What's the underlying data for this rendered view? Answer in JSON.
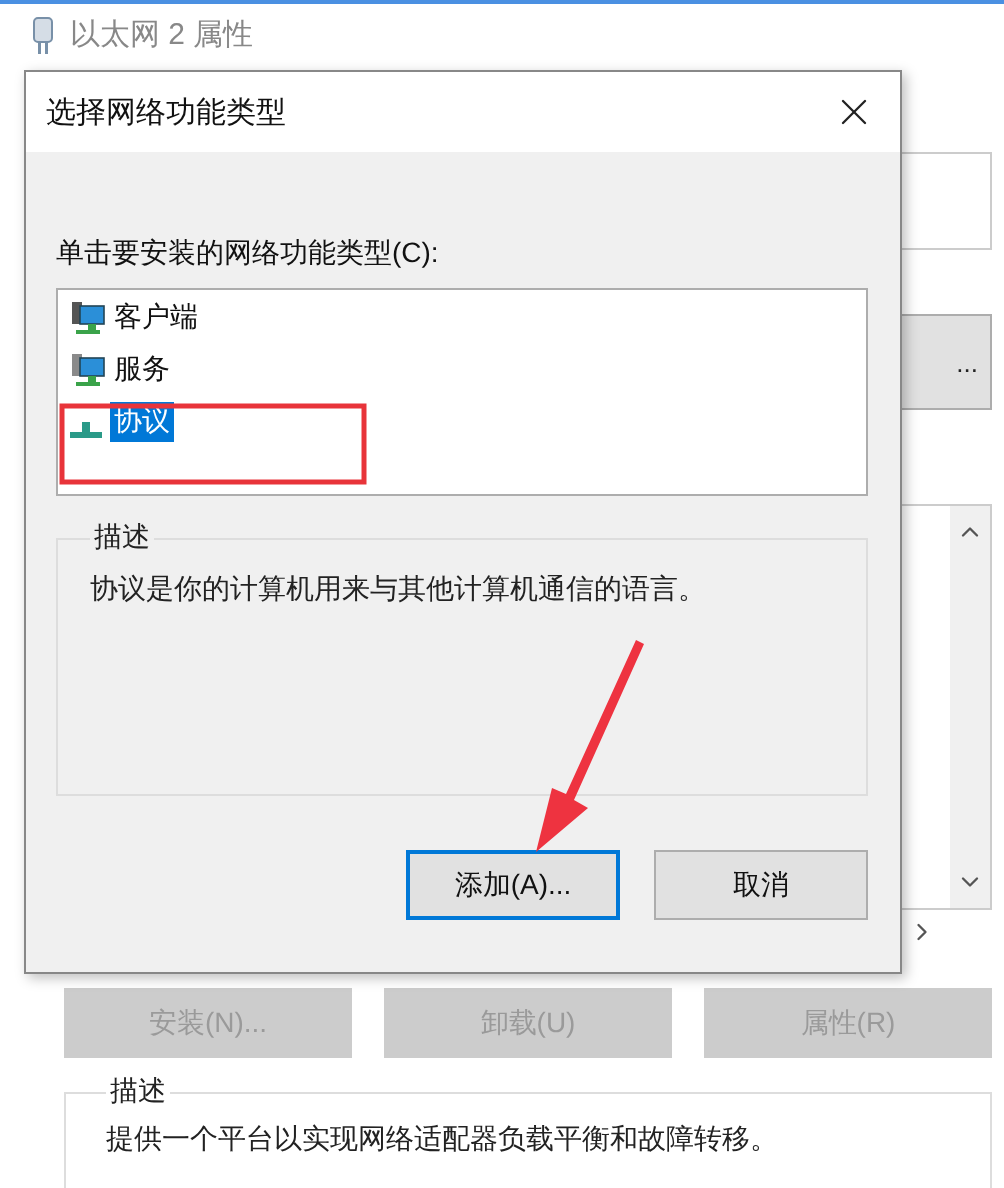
{
  "background_window": {
    "title": "以太网 2 属性",
    "partial_button": "...",
    "buttons": [
      {
        "label": "安装(N)...",
        "disabled": true
      },
      {
        "label": "卸载(U)",
        "disabled": true
      },
      {
        "label": "属性(R)",
        "disabled": true
      }
    ],
    "description": {
      "label": "描述",
      "text": "提供一个平台以实现网络适配器负载平衡和故障转移。"
    }
  },
  "dialog": {
    "title": "选择网络功能类型",
    "prompt": "单击要安装的网络功能类型(C):",
    "items": [
      {
        "label": "客户端",
        "kind": "client",
        "selected": false
      },
      {
        "label": "服务",
        "kind": "service",
        "selected": false
      },
      {
        "label": "协议",
        "kind": "protocol",
        "selected": true
      }
    ],
    "description": {
      "label": "描述",
      "text": "协议是你的计算机用来与其他计算机通信的语言。"
    },
    "buttons": [
      {
        "label": "添加(A)...",
        "default": true
      },
      {
        "label": "取消",
        "default": false
      }
    ]
  }
}
